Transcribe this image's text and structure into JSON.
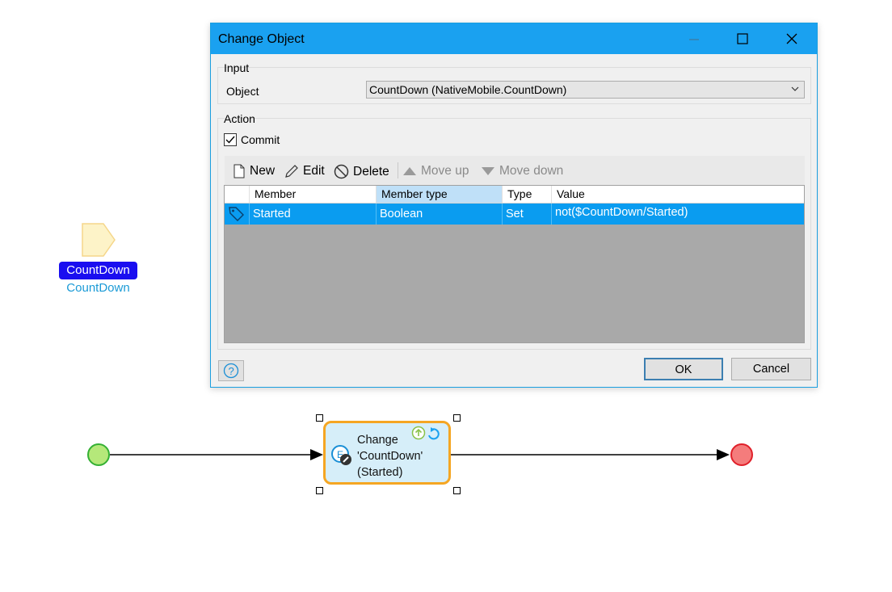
{
  "canvas": {
    "parameter": {
      "name": "CountDown",
      "type": "CountDown"
    },
    "activity": {
      "caption": "Change 'CountDown' (Started)"
    }
  },
  "dialog": {
    "title": "Change Object",
    "input_group": {
      "label": "Input",
      "object_label": "Object",
      "object_value": "CountDown (NativeMobile.CountDown)"
    },
    "action_group": {
      "label": "Action",
      "commit_label": "Commit",
      "commit_checked": true,
      "toolbar": {
        "new": "New",
        "edit": "Edit",
        "delete": "Delete",
        "move_up": "Move up",
        "move_down": "Move down"
      },
      "grid": {
        "columns": [
          "Member",
          "Member type",
          "Type",
          "Value"
        ],
        "rows": [
          {
            "member": "Started",
            "member_type": "Boolean",
            "type": "Set",
            "value": "not($CountDown/Started)"
          }
        ]
      }
    },
    "buttons": {
      "ok": "OK",
      "cancel": "Cancel"
    }
  },
  "colors": {
    "titlebar": "#1aa1f0",
    "selection": "#0a9cf0",
    "start_event": "#b5e87a",
    "end_event": "#f47c7c",
    "activity_border": "#f5a623"
  }
}
